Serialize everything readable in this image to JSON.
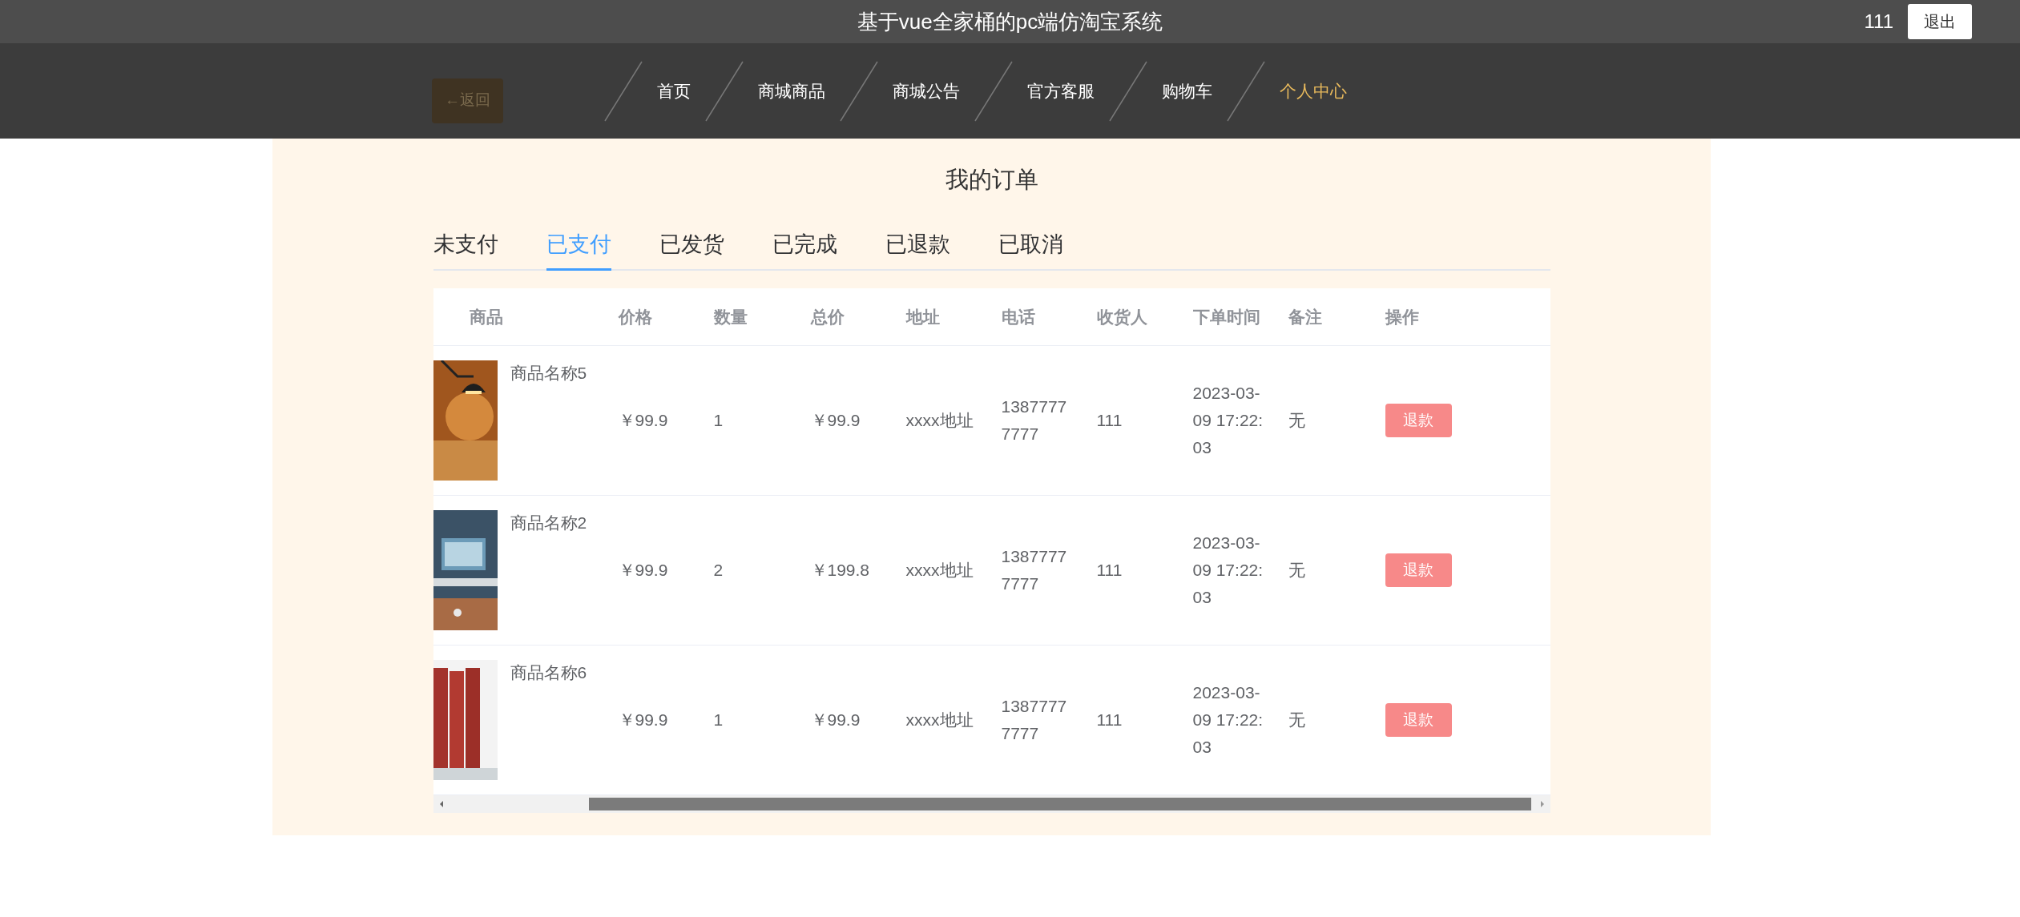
{
  "header": {
    "title": "基于vue全家桶的pc端仿淘宝系统",
    "user": "111",
    "logout": "退出"
  },
  "back_button": "←返回",
  "nav": [
    {
      "label": "首页",
      "selected": false
    },
    {
      "label": "商城商品",
      "selected": false
    },
    {
      "label": "商城公告",
      "selected": false
    },
    {
      "label": "官方客服",
      "selected": false
    },
    {
      "label": "购物车",
      "selected": false
    },
    {
      "label": "个人中心",
      "selected": true
    }
  ],
  "page_title": "我的订单",
  "tabs": [
    {
      "label": "未支付",
      "selected": false
    },
    {
      "label": "已支付",
      "selected": true
    },
    {
      "label": "已发货",
      "selected": false
    },
    {
      "label": "已完成",
      "selected": false
    },
    {
      "label": "已退款",
      "selected": false
    },
    {
      "label": "已取消",
      "selected": false
    }
  ],
  "table": {
    "columns": [
      "商品",
      "价格",
      "数量",
      "总价",
      "地址",
      "电话",
      "收货人",
      "下单时间",
      "备注",
      "操作"
    ],
    "rows": [
      {
        "name": "商品名称5",
        "price": "￥99.9",
        "quantity": "1",
        "total": "￥99.9",
        "address": "xxxx地址",
        "phone": "13877777777",
        "recipient": "111",
        "time": "2023-03-09 17:22:03",
        "note": "无",
        "action": "退款"
      },
      {
        "name": "商品名称2",
        "price": "￥99.9",
        "quantity": "2",
        "total": "￥199.8",
        "address": "xxxx地址",
        "phone": "13877777777",
        "recipient": "111",
        "time": "2023-03-09 17:22:03",
        "note": "无",
        "action": "退款"
      },
      {
        "name": "商品名称6",
        "price": "￥99.9",
        "quantity": "1",
        "total": "￥99.9",
        "address": "xxxx地址",
        "phone": "13877777777",
        "recipient": "111",
        "time": "2023-03-09 17:22:03",
        "note": "无",
        "action": "退款"
      }
    ]
  }
}
